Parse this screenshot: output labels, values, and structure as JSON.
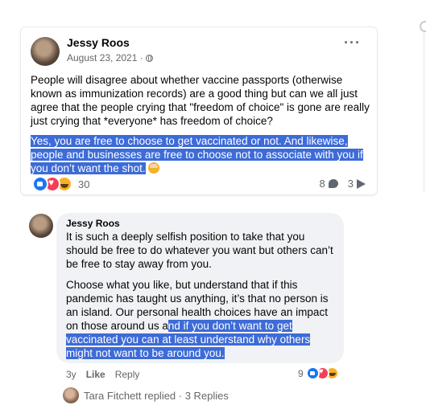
{
  "post": {
    "author": "Jessy Roos",
    "date": "August 23, 2021 ·",
    "more": "···",
    "paragraph1": "People will disagree about whether vaccine passports (otherwise known as immunization records) are a good thing but can we all just agree that the people crying that \"freedom of choice\" is gone are really just crying that *everyone* has freedom of choice?",
    "paragraph2_highlighted": "Yes, you are free to choose to get vaccinated or not. And likewise, people and businesses are free to choose not to associate with you if you don’t want the shot.",
    "reaction_count": "30",
    "comment_count": "8",
    "share_count": "3",
    "icons": [
      "globe-icon",
      "more-icon",
      "like-reaction-icon",
      "love-reaction-icon",
      "haha-reaction-icon",
      "comment-icon",
      "share-icon"
    ]
  },
  "comment": {
    "author": "Jessy Roos",
    "paragraph1": "It is such a deeply selfish position to take that you should be free to do whatever you want but others can’t be free to stay away from you.",
    "paragraph2_plain": "Choose what you like, but understand that if this pandemic has taught us anything, it’s that no person is an island. Our personal health choices have an impact on those around us a",
    "paragraph2_highlighted": "nd if you don’t want to get vaccinated you can at least understand why others might not want to be around you.",
    "time": "3y",
    "like_label": "Like",
    "reply_label": "Reply",
    "reaction_count": "9"
  },
  "replies": {
    "text": "Tara Fitchett replied · 3 Replies"
  },
  "colors": {
    "highlight": "#3d6bd7",
    "like": "#1877f2",
    "love": "#f33e58",
    "haha": "#f7b125",
    "bubble": "#f0f2f5",
    "secondary_text": "#65676b"
  }
}
